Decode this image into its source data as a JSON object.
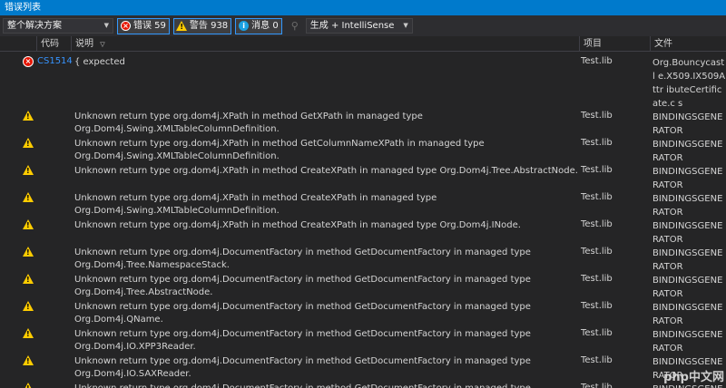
{
  "window": {
    "title": "错误列表"
  },
  "toolbar": {
    "scope": "整个解决方案",
    "errors_label": "错误 59",
    "warnings_label": "警告 938",
    "messages_label": "消息 0",
    "source": "生成 + IntelliSense"
  },
  "columns": {
    "code": "代码",
    "description": "说明",
    "project": "项目",
    "file": "文件"
  },
  "rows": [
    {
      "type": "error",
      "code": "CS1514",
      "description": "{ expected",
      "project": "Test.lib",
      "file": "Org.Bouncycastl e.X509.IX509Attr ibuteCertificate.c s"
    },
    {
      "type": "warning",
      "code": "",
      "description": "Unknown return type org.dom4j.XPath in method GetXPath in managed type Org.Dom4j.Swing.XMLTableColumnDefinition.",
      "project": "Test.lib",
      "file": "BINDINGSGENE RATOR"
    },
    {
      "type": "warning",
      "code": "",
      "description": "Unknown return type org.dom4j.XPath in method GetColumnNameXPath in managed type Org.Dom4j.Swing.XMLTableColumnDefinition.",
      "project": "Test.lib",
      "file": "BINDINGSGENE RATOR"
    },
    {
      "type": "warning",
      "code": "",
      "description": "Unknown return type org.dom4j.XPath in method CreateXPath in managed type Org.Dom4j.Tree.AbstractNode.",
      "project": "Test.lib",
      "file": "BINDINGSGENE RATOR"
    },
    {
      "type": "warning",
      "code": "",
      "description": "Unknown return type org.dom4j.XPath in method CreateXPath in managed type Org.Dom4j.Swing.XMLTableColumnDefinition.",
      "project": "Test.lib",
      "file": "BINDINGSGENE RATOR"
    },
    {
      "type": "warning",
      "code": "",
      "description": "Unknown return type org.dom4j.XPath in method CreateXPath in managed type Org.Dom4j.INode.",
      "project": "Test.lib",
      "file": "BINDINGSGENE RATOR"
    },
    {
      "type": "warning",
      "code": "",
      "description": "Unknown return type org.dom4j.DocumentFactory in method GetDocumentFactory in managed type Org.Dom4j.Tree.NamespaceStack.",
      "project": "Test.lib",
      "file": "BINDINGSGENE RATOR"
    },
    {
      "type": "warning",
      "code": "",
      "description": "Unknown return type org.dom4j.DocumentFactory in method GetDocumentFactory in managed type Org.Dom4j.Tree.AbstractNode.",
      "project": "Test.lib",
      "file": "BINDINGSGENE RATOR"
    },
    {
      "type": "warning",
      "code": "",
      "description": "Unknown return type org.dom4j.DocumentFactory in method GetDocumentFactory in managed type Org.Dom4j.QName.",
      "project": "Test.lib",
      "file": "BINDINGSGENE RATOR"
    },
    {
      "type": "warning",
      "code": "",
      "description": "Unknown return type org.dom4j.DocumentFactory in method GetDocumentFactory in managed type Org.Dom4j.IO.XPP3Reader.",
      "project": "Test.lib",
      "file": "BINDINGSGENE RATOR"
    },
    {
      "type": "warning",
      "code": "",
      "description": "Unknown return type org.dom4j.DocumentFactory in method GetDocumentFactory in managed type Org.Dom4j.IO.SAXReader.",
      "project": "Test.lib",
      "file": "BINDINGSGENE RATOR"
    },
    {
      "type": "warning",
      "code": "",
      "description": "Unknown return type org.dom4j.DocumentFactory in method GetDocumentFactory in managed type",
      "project": "Test.lib",
      "file": "BINDINGSGENE"
    }
  ],
  "watermark": "php中文网",
  "colors": {
    "accent": "#007acc",
    "link": "#3794ff",
    "error": "#e51400",
    "warning": "#ffcc00",
    "info": "#1ba1e2"
  }
}
